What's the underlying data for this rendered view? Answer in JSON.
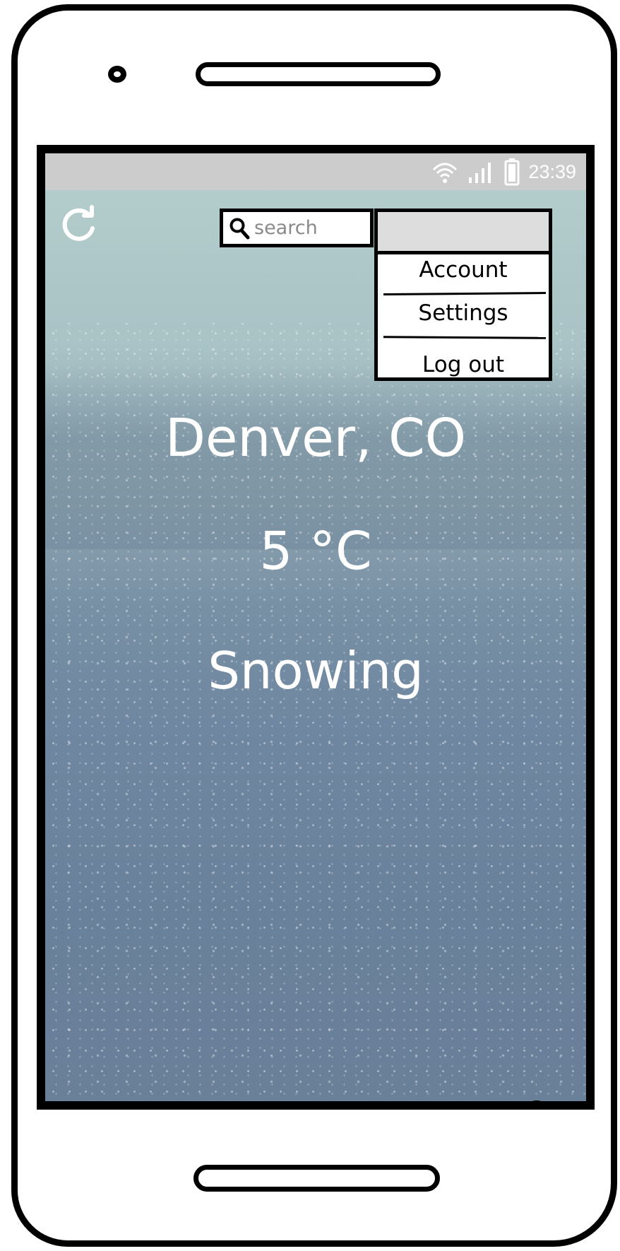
{
  "status_bar": {
    "time": "23:39",
    "icons": [
      "wifi-icon",
      "signal-icon",
      "battery-icon"
    ]
  },
  "toolbar": {
    "refresh_icon": "refresh-icon",
    "search_placeholder": "search",
    "search_icon": "search-icon"
  },
  "menu": {
    "items": [
      {
        "label": "Account"
      },
      {
        "label": "Settings"
      },
      {
        "label": "Log out"
      }
    ]
  },
  "weather": {
    "location": "Denver, CO",
    "temperature": "5 °C",
    "condition": "Snowing"
  },
  "help": {
    "label": "?"
  },
  "colors": {
    "status_bar_bg": "#cccccc",
    "menu_header_bg": "#dddddd",
    "weather_text": "#ffffff"
  }
}
